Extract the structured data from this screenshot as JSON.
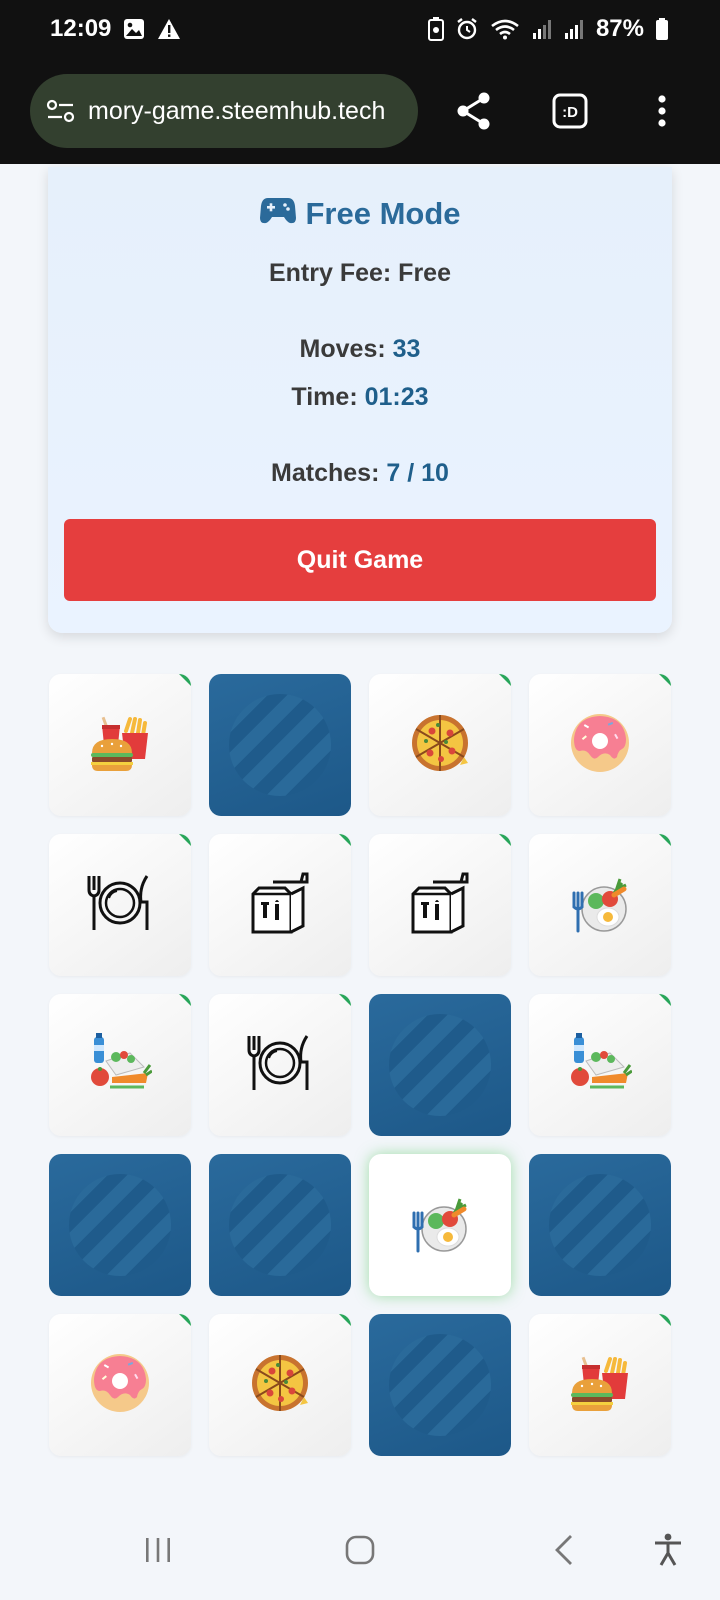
{
  "status_bar": {
    "time": "12:09",
    "battery": "87%"
  },
  "browser": {
    "url": "mory-game.steemhub.tech",
    "tab_badge": ":D"
  },
  "game": {
    "mode_icon": "gamepad-icon",
    "mode_title": "Free Mode",
    "entry_fee": "Entry Fee: Free",
    "moves_label": "Moves:",
    "moves_value": "33",
    "time_label": "Time:",
    "time_value": "01:23",
    "matches_label": "Matches:",
    "matches_value": "7 / 10",
    "quit_label": "Quit Game"
  },
  "board": {
    "tiles": [
      {
        "state": "revealed",
        "icon": "burger-fries-drink-icon"
      },
      {
        "state": "hidden"
      },
      {
        "state": "revealed",
        "icon": "pizza-icon"
      },
      {
        "state": "revealed",
        "icon": "donut-icon"
      },
      {
        "state": "revealed",
        "icon": "plate-cutlery-icon"
      },
      {
        "state": "revealed",
        "icon": "takeaway-bag-icon"
      },
      {
        "state": "revealed",
        "icon": "takeaway-bag-icon"
      },
      {
        "state": "revealed",
        "icon": "salad-bowl-icon"
      },
      {
        "state": "revealed",
        "icon": "healthy-food-icon"
      },
      {
        "state": "revealed",
        "icon": "plate-cutlery-icon"
      },
      {
        "state": "hidden"
      },
      {
        "state": "revealed",
        "icon": "healthy-food-icon"
      },
      {
        "state": "hidden"
      },
      {
        "state": "hidden"
      },
      {
        "state": "active",
        "icon": "salad-bowl-icon"
      },
      {
        "state": "hidden"
      },
      {
        "state": "revealed",
        "icon": "donut-icon"
      },
      {
        "state": "revealed",
        "icon": "pizza-icon"
      },
      {
        "state": "hidden"
      },
      {
        "state": "revealed",
        "icon": "burger-fries-drink-icon"
      }
    ]
  },
  "colors": {
    "accent": "#2b6a9a",
    "quit": "#e53e3e",
    "hidden_tile": "#1f5b8b",
    "matched_marker": "#27a55a"
  }
}
